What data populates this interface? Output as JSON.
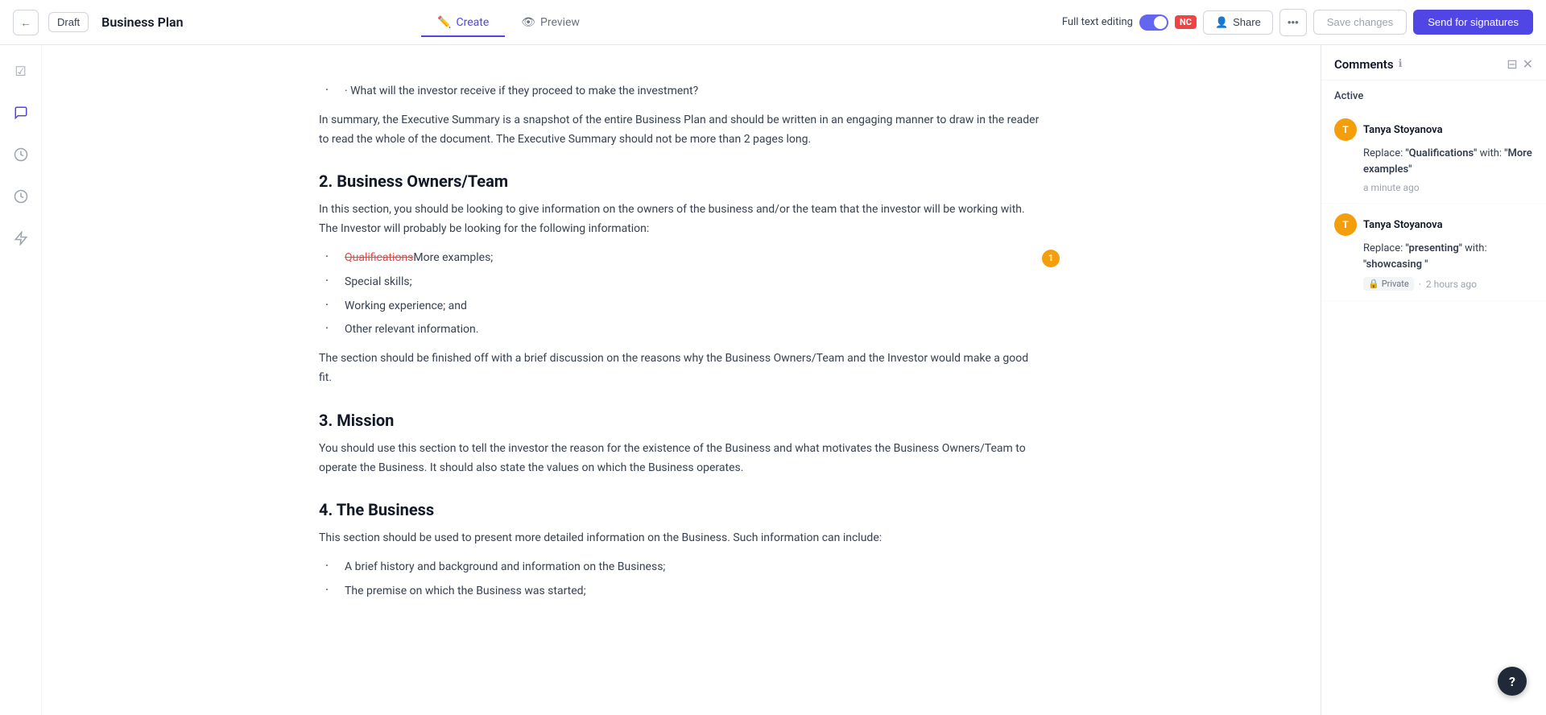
{
  "topbar": {
    "back_icon": "←",
    "draft_label": "Draft",
    "doc_title": "Business Plan",
    "tabs": [
      {
        "id": "create",
        "label": "Create",
        "icon": "✏️",
        "active": true
      },
      {
        "id": "preview",
        "label": "Preview",
        "icon": "👁",
        "active": false
      }
    ],
    "full_text_editing_label": "Full text editing",
    "nc_badge": "NC",
    "share_label": "Share",
    "share_icon": "👤",
    "more_icon": "•••",
    "save_label": "Save changes",
    "send_label": "Send for signatures"
  },
  "sidebar_icons": [
    "☑",
    "💬",
    "🕐",
    "🕐",
    "⚡"
  ],
  "document": {
    "bullet_intro": "· What will the investor receive if they proceed to make the investment?",
    "summary_para": "In summary, the Executive Summary is a snapshot of the entire Business Plan and should be written in an engaging manner to draw in the reader to read the whole of the document. The Executive Summary should not be more than 2 pages long.",
    "section2_title": "2. Business Owners/Team",
    "section2_intro": "In this section, you should be looking to give information on the owners of the business and/or the team that the investor will be working with. The Investor will probably be looking for the following information:",
    "bullets2": [
      {
        "strikethrough": "Qualifications",
        "inserted": "More examples;"
      },
      {
        "text": "Special skills;"
      },
      {
        "text": "Working experience; and"
      },
      {
        "text": "Other relevant information."
      }
    ],
    "section2_outro": "The section should be finished off with a brief discussion on the reasons why the Business Owners/Team and the Investor would make a good fit.",
    "section3_title": "3. Mission",
    "section3_para": "You should use this section to tell the investor the reason for the existence of the Business and what motivates the Business Owners/Team to operate the Business. It should also state the values on which the Business operates.",
    "section4_title": "4. The Business",
    "section4_intro": "This section should be used to present more detailed information on the Business. Such information can include:",
    "bullets4": [
      {
        "text": "A brief history and background and information on the Business;"
      },
      {
        "text": "The premise on which the Business was started;"
      }
    ]
  },
  "comment_bubble": {
    "count": "1"
  },
  "comments_panel": {
    "title": "Comments",
    "info_icon": "ℹ",
    "active_tab": "Active",
    "comments": [
      {
        "id": 1,
        "author": "Tanya Stoyanova",
        "avatar_letter": "T",
        "avatar_color": "#f59e0b",
        "body_prefix": "Replace: ",
        "original": "\"Qualifications\"",
        "with_label": " with: ",
        "replacement": "\"More examples\"",
        "timestamp": "a minute ago",
        "is_private": false
      },
      {
        "id": 2,
        "author": "Tanya Stoyanova",
        "avatar_letter": "T",
        "avatar_color": "#f59e0b",
        "body_prefix": "Replace: ",
        "original": "\"presenting\"",
        "with_label": " with: ",
        "replacement": "\"showcasing \"",
        "timestamp": "2 hours ago",
        "is_private": true,
        "private_label": "Private"
      }
    ]
  },
  "help_btn": "?"
}
